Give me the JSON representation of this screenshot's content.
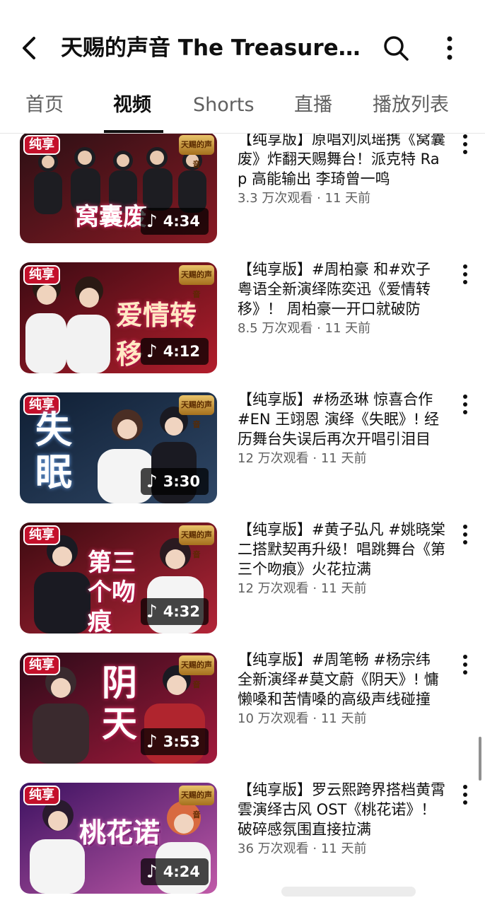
{
  "header": {
    "title": "天赐的声音 The Treasured Voice",
    "back_icon": "chevron-left-icon",
    "search_icon": "search-icon",
    "more_icon": "more-vertical-icon"
  },
  "tabs": [
    {
      "label": "首页",
      "active": false
    },
    {
      "label": "视频",
      "active": true
    },
    {
      "label": "Shorts",
      "active": false
    },
    {
      "label": "直播",
      "active": false
    },
    {
      "label": "播放列表",
      "active": false
    }
  ],
  "thumb_badges": {
    "left": "纯享",
    "right": "天赐的声音"
  },
  "videos": [
    {
      "title": "【纯享版】原唱刘凤瑶携《窝囊废》炸翻天赐舞台！派克特 Rap 高能输出 李琦曾一鸣",
      "views": "3.3 万次观看",
      "age": "11 天前",
      "duration": "4:34",
      "song": "窝囊废",
      "colors": [
        "#2a0f14",
        "#8a1a24"
      ]
    },
    {
      "title": "【纯享版】#周柏豪 和#欢子 粤语全新演绎陈奕迅《爱情转移》！ 周柏豪一开口就破防",
      "views": "8.5 万次观看",
      "age": "11 天前",
      "duration": "4:12",
      "song": "爱情转移",
      "colors": [
        "#3a0a12",
        "#b21e2c"
      ]
    },
    {
      "title": "【纯享版】#杨丞琳 惊喜合作 #EN 王翊恩 演绎《失眠》! 经历舞台失误后再次开唱引泪目",
      "views": "12 万次观看",
      "age": "11 天前",
      "duration": "3:30",
      "song": "失眠",
      "colors": [
        "#0f1e33",
        "#2f4766"
      ]
    },
    {
      "title": "【纯享版】#黄子弘凡 #姚晓棠 二搭默契再升级！唱跳舞台《第三个吻痕》火花拉满",
      "views": "12 万次观看",
      "age": "11 天前",
      "duration": "4:32",
      "song": "第三个吻痕",
      "colors": [
        "#3b0a10",
        "#b32538"
      ]
    },
    {
      "title": "【纯享版】#周笔畅 #杨宗纬 全新演绎#莫文蔚《阴天》! 慵懒嗓和苦情嗓的高级声线碰撞",
      "views": "10 万次观看",
      "age": "11 天前",
      "duration": "3:53",
      "song": "阴天",
      "colors": [
        "#2c0a18",
        "#a31a3c"
      ]
    },
    {
      "title": "【纯享版】罗云熙跨界搭档黄霄雲演绎古风 OST《桃花诺》！破碎感氛围直接拉满",
      "views": "36 万次观看",
      "age": "11 天前",
      "duration": "4:24",
      "song": "桃花诺",
      "colors": [
        "#3b1160",
        "#c05aa8"
      ]
    }
  ]
}
